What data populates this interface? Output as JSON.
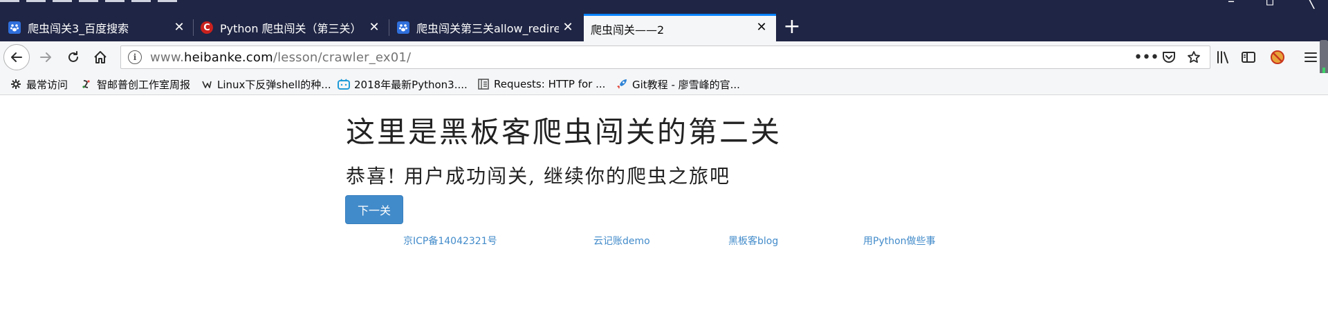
{
  "tabs": [
    {
      "title": "爬虫闯关3_百度搜索",
      "icon": "baidu-paw-icon",
      "active": false
    },
    {
      "title": "Python 爬虫闯关（第三关） -",
      "icon": "csdn-icon",
      "active": false
    },
    {
      "title": "爬虫闯关第三关allow_redirect",
      "icon": "baidu-paw-icon",
      "active": false
    },
    {
      "title": "爬虫闯关——2",
      "icon": null,
      "active": true
    }
  ],
  "new_tab_label": "+",
  "url": {
    "prefix": "www.",
    "host": "heibanke.com",
    "path": "/lesson/crawler_ex01/"
  },
  "bookmarks": [
    {
      "label": "最常访问",
      "icon": "gear-icon"
    },
    {
      "label": "智邮普创工作室周报",
      "icon": "bookmark-favicon"
    },
    {
      "label": "Linux下反弹shell的种...",
      "icon": "bookmark-favicon"
    },
    {
      "label": "2018年最新Python3....",
      "icon": "bilibili-icon"
    },
    {
      "label": "Requests: HTTP for ...",
      "icon": "document-icon"
    },
    {
      "label": "Git教程 - 廖雪峰的官...",
      "icon": "rocket-icon"
    }
  ],
  "page": {
    "title": "这里是黑板客爬虫闯关的第二关",
    "subtitle": "恭喜! 用户成功闯关, 继续你的爬虫之旅吧",
    "next_button": "下一关",
    "footer_links": [
      "京ICP备14042321号",
      "云记账demo",
      "黑板客blog",
      "用Python做些事"
    ]
  },
  "colors": {
    "tabstrip": "#1f2544",
    "active_tab_accent": "#0a84ff",
    "button_blue": "#428bca",
    "link_blue": "#428bca"
  }
}
